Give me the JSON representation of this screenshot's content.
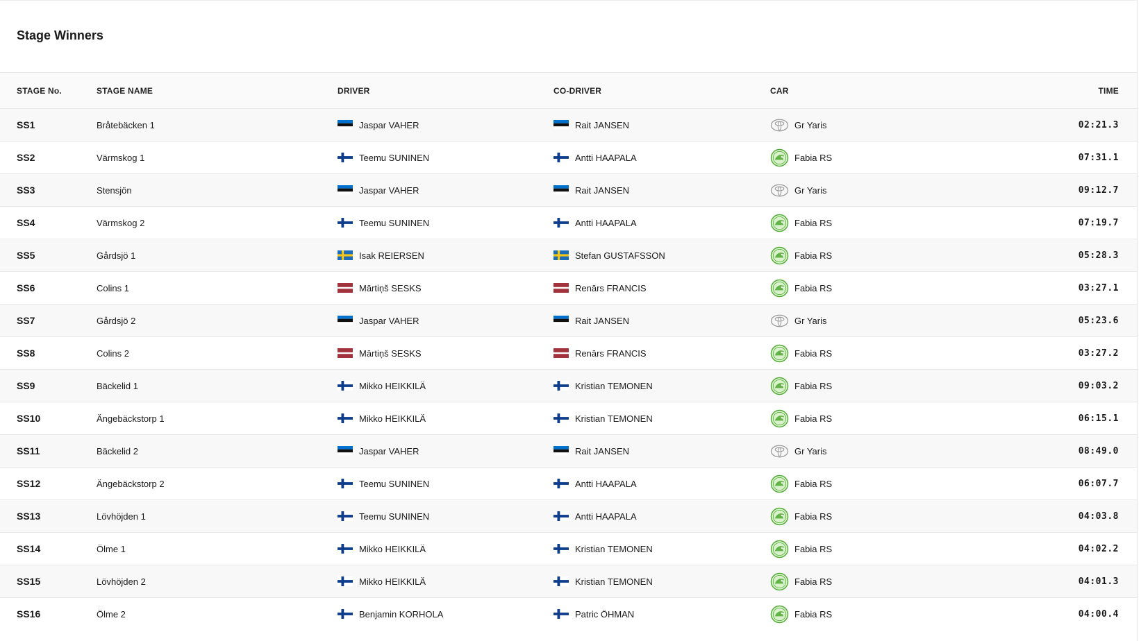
{
  "title": "Stage Winners",
  "columns": {
    "stage": "STAGE No.",
    "name": "STAGE NAME",
    "driver": "DRIVER",
    "codriver": "CO-DRIVER",
    "car": "CAR",
    "time": "TIME"
  },
  "colors": {
    "toyota_logo": "#9a9a9a",
    "skoda_logo": "#4ba82e",
    "skoda_logo_fill": "#d9f2cc"
  },
  "rows": [
    {
      "stage": "SS1",
      "name": "Bråtebäcken 1",
      "driver": "Jaspar VAHER",
      "driver_flag": "estonia-flag",
      "codriver": "Rait JANSEN",
      "codriver_flag": "estonia-flag",
      "car": "Gr Yaris",
      "car_icon": "toyota-logo-icon",
      "time": "02:21.3"
    },
    {
      "stage": "SS2",
      "name": "Värmskog 1",
      "driver": "Teemu SUNINEN",
      "driver_flag": "finland-flag",
      "codriver": "Antti HAAPALA",
      "codriver_flag": "finland-flag",
      "car": "Fabia RS",
      "car_icon": "skoda-logo-icon",
      "time": "07:31.1"
    },
    {
      "stage": "SS3",
      "name": "Stensjön",
      "driver": "Jaspar VAHER",
      "driver_flag": "estonia-flag",
      "codriver": "Rait JANSEN",
      "codriver_flag": "estonia-flag",
      "car": "Gr Yaris",
      "car_icon": "toyota-logo-icon",
      "time": "09:12.7"
    },
    {
      "stage": "SS4",
      "name": "Värmskog 2",
      "driver": "Teemu SUNINEN",
      "driver_flag": "finland-flag",
      "codriver": "Antti HAAPALA",
      "codriver_flag": "finland-flag",
      "car": "Fabia RS",
      "car_icon": "skoda-logo-icon",
      "time": "07:19.7"
    },
    {
      "stage": "SS5",
      "name": "Gårdsjö 1",
      "driver": "Isak REIERSEN",
      "driver_flag": "sweden-flag",
      "codriver": "Stefan GUSTAFSSON",
      "codriver_flag": "sweden-flag",
      "car": "Fabia RS",
      "car_icon": "skoda-logo-icon",
      "time": "05:28.3"
    },
    {
      "stage": "SS6",
      "name": "Colins 1",
      "driver": "Mārtiņš SESKS",
      "driver_flag": "latvia-flag",
      "codriver": "Renārs FRANCIS",
      "codriver_flag": "latvia-flag",
      "car": "Fabia RS",
      "car_icon": "skoda-logo-icon",
      "time": "03:27.1"
    },
    {
      "stage": "SS7",
      "name": "Gårdsjö 2",
      "driver": "Jaspar VAHER",
      "driver_flag": "estonia-flag",
      "codriver": "Rait JANSEN",
      "codriver_flag": "estonia-flag",
      "car": "Gr Yaris",
      "car_icon": "toyota-logo-icon",
      "time": "05:23.6"
    },
    {
      "stage": "SS8",
      "name": "Colins 2",
      "driver": "Mārtiņš SESKS",
      "driver_flag": "latvia-flag",
      "codriver": "Renārs FRANCIS",
      "codriver_flag": "latvia-flag",
      "car": "Fabia RS",
      "car_icon": "skoda-logo-icon",
      "time": "03:27.2"
    },
    {
      "stage": "SS9",
      "name": "Bäckelid 1",
      "driver": "Mikko HEIKKILÄ",
      "driver_flag": "finland-flag",
      "codriver": "Kristian TEMONEN",
      "codriver_flag": "finland-flag",
      "car": "Fabia RS",
      "car_icon": "skoda-logo-icon",
      "time": "09:03.2"
    },
    {
      "stage": "SS10",
      "name": "Ängebäckstorp 1",
      "driver": "Mikko HEIKKILÄ",
      "driver_flag": "finland-flag",
      "codriver": "Kristian TEMONEN",
      "codriver_flag": "finland-flag",
      "car": "Fabia RS",
      "car_icon": "skoda-logo-icon",
      "time": "06:15.1"
    },
    {
      "stage": "SS11",
      "name": "Bäckelid 2",
      "driver": "Jaspar VAHER",
      "driver_flag": "estonia-flag",
      "codriver": "Rait JANSEN",
      "codriver_flag": "estonia-flag",
      "car": "Gr Yaris",
      "car_icon": "toyota-logo-icon",
      "time": "08:49.0"
    },
    {
      "stage": "SS12",
      "name": "Ängebäckstorp 2",
      "driver": "Teemu SUNINEN",
      "driver_flag": "finland-flag",
      "codriver": "Antti HAAPALA",
      "codriver_flag": "finland-flag",
      "car": "Fabia RS",
      "car_icon": "skoda-logo-icon",
      "time": "06:07.7"
    },
    {
      "stage": "SS13",
      "name": "Lövhöjden 1",
      "driver": "Teemu SUNINEN",
      "driver_flag": "finland-flag",
      "codriver": "Antti HAAPALA",
      "codriver_flag": "finland-flag",
      "car": "Fabia RS",
      "car_icon": "skoda-logo-icon",
      "time": "04:03.8"
    },
    {
      "stage": "SS14",
      "name": "Ölme 1",
      "driver": "Mikko HEIKKILÄ",
      "driver_flag": "finland-flag",
      "codriver": "Kristian TEMONEN",
      "codriver_flag": "finland-flag",
      "car": "Fabia RS",
      "car_icon": "skoda-logo-icon",
      "time": "04:02.2"
    },
    {
      "stage": "SS15",
      "name": "Lövhöjden 2",
      "driver": "Mikko HEIKKILÄ",
      "driver_flag": "finland-flag",
      "codriver": "Kristian TEMONEN",
      "codriver_flag": "finland-flag",
      "car": "Fabia RS",
      "car_icon": "skoda-logo-icon",
      "time": "04:01.3"
    },
    {
      "stage": "SS16",
      "name": "Ölme 2",
      "driver": "Benjamin KORHOLA",
      "driver_flag": "finland-flag",
      "codriver": "Patric ÖHMAN",
      "codriver_flag": "finland-flag",
      "car": "Fabia RS",
      "car_icon": "skoda-logo-icon",
      "time": "04:00.4"
    }
  ]
}
